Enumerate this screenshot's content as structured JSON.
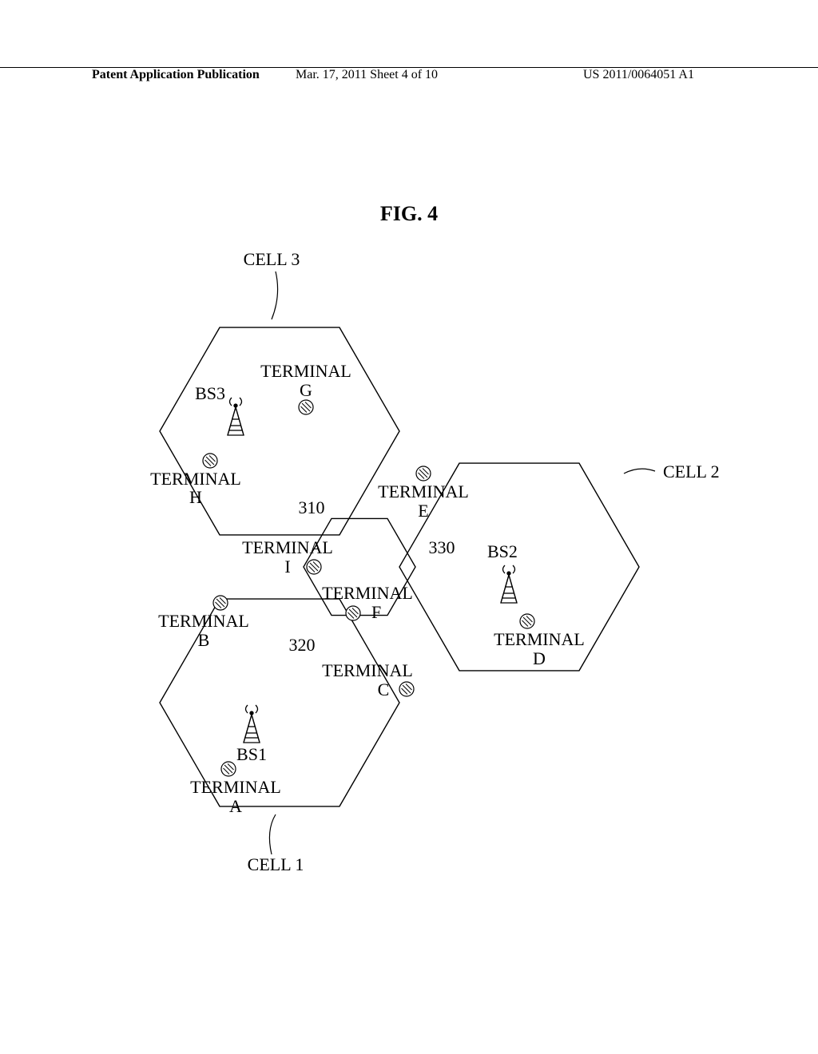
{
  "header": {
    "left": "Patent Application Publication",
    "center": "Mar. 17, 2011  Sheet 4 of 10",
    "right": "US 2011/0064051 A1"
  },
  "figure": {
    "title": "FIG. 4"
  },
  "cells": {
    "cell3_label": "CELL 3",
    "cell2_label": "CELL 2",
    "cell1_label": "CELL 1"
  },
  "regions": {
    "r310": "310",
    "r320": "320",
    "r330": "330"
  },
  "bs": {
    "bs1": "BS1",
    "bs2": "BS2",
    "bs3": "BS3"
  },
  "terminals": {
    "A": {
      "line1": "TERMINAL",
      "line2": "A"
    },
    "B": {
      "line1": "TERMINAL",
      "line2": "B"
    },
    "C": {
      "line1": "TERMINAL",
      "line2": "C"
    },
    "D": {
      "line1": "TERMINAL",
      "line2": "D"
    },
    "E": {
      "line1": "TERMINAL",
      "line2": "E"
    },
    "F": {
      "line1": "TERMINAL",
      "line2": "F"
    },
    "G": {
      "line1": "TERMINAL",
      "line2": "G"
    },
    "H": {
      "line1": "TERMINAL",
      "line2": "H"
    },
    "I": {
      "line1": "TERMINAL",
      "line2": "I"
    }
  }
}
